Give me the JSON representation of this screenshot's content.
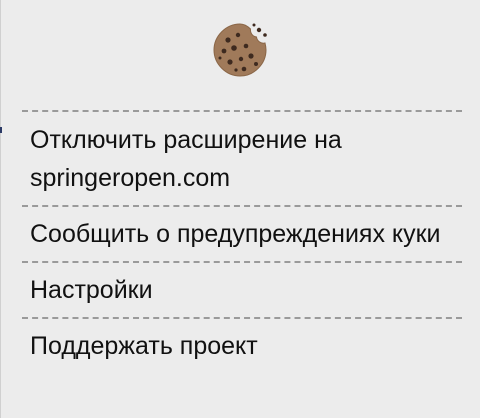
{
  "app": {
    "logo_icon": "cookie-icon"
  },
  "menu": {
    "items": [
      {
        "label": "Отключить расширение на springeropen.com"
      },
      {
        "label": "Сообщить о предупреждениях куки"
      },
      {
        "label": "Настройки"
      },
      {
        "label": "Поддержать проект"
      }
    ]
  },
  "colors": {
    "background": "#ececec",
    "separator": "#9a9a9a",
    "text": "#111111",
    "cookie": "#a07a5a",
    "cookie_chip": "#3e2a1f"
  }
}
